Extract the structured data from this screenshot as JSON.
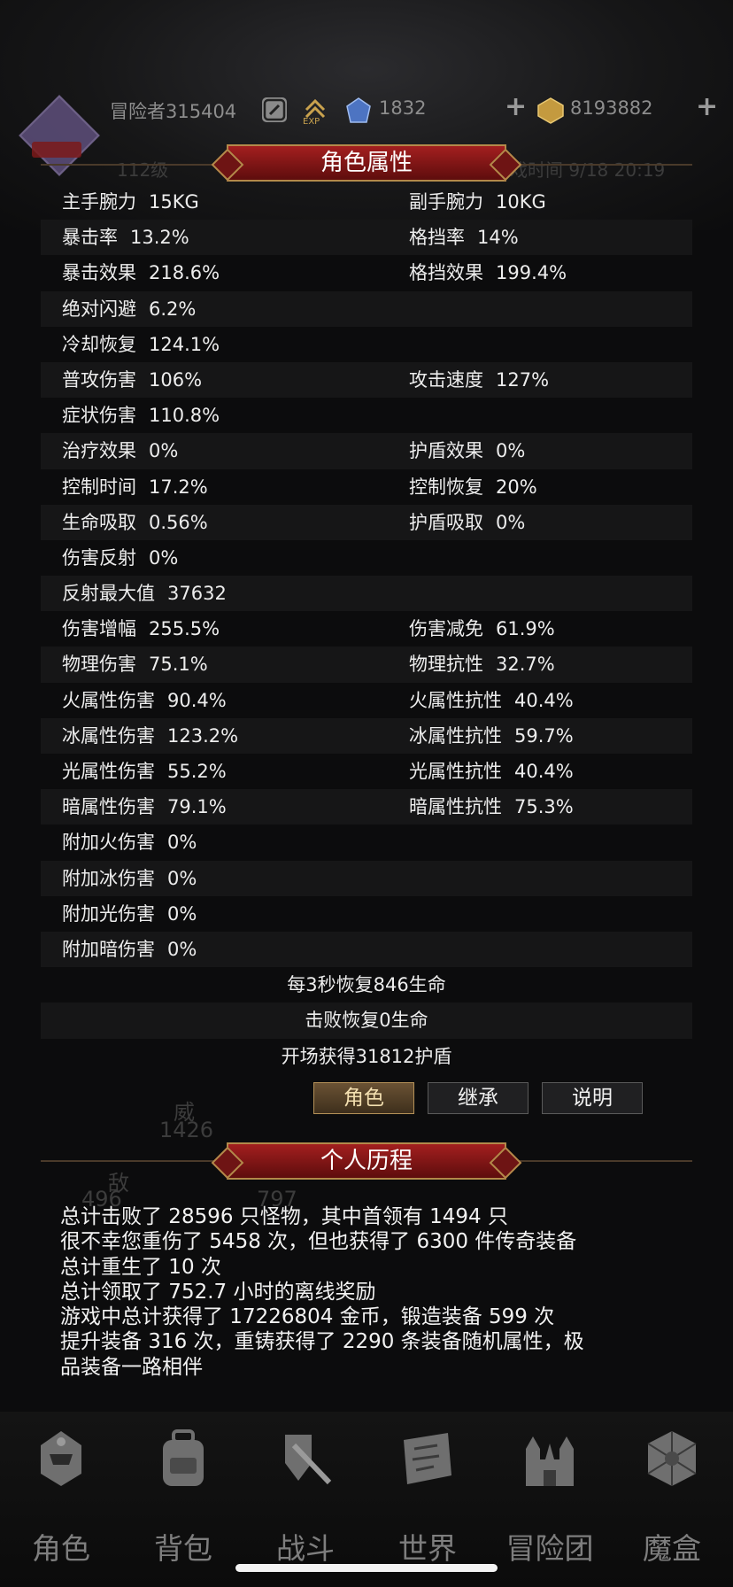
{
  "topbar": {
    "player_name": "冒险者315404",
    "gems": "1832",
    "gold": "8193882",
    "exp_label": "EXP"
  },
  "attr_panel": {
    "title": "角色属性",
    "rows": [
      {
        "a_label": "主手腕力",
        "a_value": "15KG",
        "b_label": "副手腕力",
        "b_value": "10KG"
      },
      {
        "a_label": "暴击率",
        "a_value": "13.2%",
        "b_label": "格挡率",
        "b_value": "14%"
      },
      {
        "a_label": "暴击效果",
        "a_value": "218.6%",
        "b_label": "格挡效果",
        "b_value": "199.4%"
      },
      {
        "a_label": "绝对闪避",
        "a_value": "6.2%",
        "b_label": "",
        "b_value": ""
      },
      {
        "a_label": "冷却恢复",
        "a_value": "124.1%",
        "b_label": "",
        "b_value": ""
      },
      {
        "a_label": "普攻伤害",
        "a_value": "106%",
        "b_label": "攻击速度",
        "b_value": "127%"
      },
      {
        "a_label": "症状伤害",
        "a_value": "110.8%",
        "b_label": "",
        "b_value": ""
      },
      {
        "a_label": "治疗效果",
        "a_value": "0%",
        "b_label": "护盾效果",
        "b_value": "0%"
      },
      {
        "a_label": "控制时间",
        "a_value": "17.2%",
        "b_label": "控制恢复",
        "b_value": "20%"
      },
      {
        "a_label": "生命吸取",
        "a_value": "0.56%",
        "b_label": "护盾吸取",
        "b_value": "0%"
      },
      {
        "a_label": "伤害反射",
        "a_value": "0%",
        "b_label": "",
        "b_value": ""
      },
      {
        "a_label": "反射最大值",
        "a_value": "37632",
        "b_label": "",
        "b_value": ""
      },
      {
        "a_label": "伤害增幅",
        "a_value": "255.5%",
        "b_label": "伤害减免",
        "b_value": "61.9%"
      },
      {
        "a_label": "物理伤害",
        "a_value": "75.1%",
        "b_label": "物理抗性",
        "b_value": "32.7%"
      },
      {
        "a_label": "火属性伤害",
        "a_value": "90.4%",
        "b_label": "火属性抗性",
        "b_value": "40.4%"
      },
      {
        "a_label": "冰属性伤害",
        "a_value": "123.2%",
        "b_label": "冰属性抗性",
        "b_value": "59.7%"
      },
      {
        "a_label": "光属性伤害",
        "a_value": "55.2%",
        "b_label": "光属性抗性",
        "b_value": "40.4%"
      },
      {
        "a_label": "暗属性伤害",
        "a_value": "79.1%",
        "b_label": "暗属性抗性",
        "b_value": "75.3%"
      },
      {
        "a_label": "附加火伤害",
        "a_value": "0%",
        "b_label": "",
        "b_value": ""
      },
      {
        "a_label": "附加冰伤害",
        "a_value": "0%",
        "b_label": "",
        "b_value": ""
      },
      {
        "a_label": "附加光伤害",
        "a_value": "0%",
        "b_label": "",
        "b_value": ""
      },
      {
        "a_label": "附加暗伤害",
        "a_value": "0%",
        "b_label": "",
        "b_value": ""
      }
    ],
    "summary": [
      "每3秒恢复846生命",
      "击败恢复0生命",
      "开场获得31812护盾"
    ],
    "tabs": [
      {
        "label": "角色",
        "active": true
      },
      {
        "label": "继承",
        "active": false
      },
      {
        "label": "说明",
        "active": false
      }
    ]
  },
  "history": {
    "title": "个人历程",
    "lines": [
      "总计击败了 28596 只怪物，其中首领有 1494 只",
      "很不幸您重伤了 5458 次，但也获得了 6300 件传奇装备",
      "总计重生了 10 次",
      "总计领取了 752.7 小时的离线奖励",
      "游戏中总计获得了 17226804 金币，锻造装备 599 次",
      "提升装备 316 次，重铸获得了 2290 条装备随机属性，极",
      "品装备一路相伴"
    ]
  },
  "bottom_nav": [
    {
      "label": "角色"
    },
    {
      "label": "背包"
    },
    {
      "label": "战斗"
    },
    {
      "label": "世界"
    },
    {
      "label": "冒险团"
    },
    {
      "label": "魔盒"
    }
  ],
  "colors": {
    "ribbon": "#a31f1f",
    "ribbon_border": "#b3894a",
    "active_tab": "#6a5234"
  }
}
